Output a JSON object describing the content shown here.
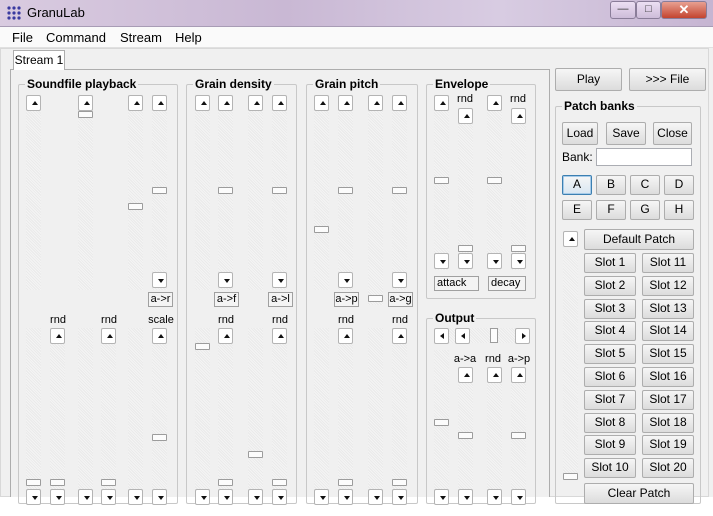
{
  "window": {
    "title": "GranuLab",
    "min": "—",
    "max": "□",
    "close": "✕"
  },
  "menu": [
    "File",
    "Command",
    "Stream",
    "Help"
  ],
  "tab": "Stream 1",
  "groups": {
    "soundfile": "Soundfile playback",
    "density": "Grain density",
    "pitch": "Grain pitch",
    "envelope": "Envelope",
    "output": "Output",
    "patchbanks": "Patch banks"
  },
  "labels": {
    "rnd": "rnd",
    "scale": "scale",
    "ar": "a->r",
    "af": "a->f",
    "al": "a->l",
    "ap": "a->p",
    "ag": "a->g",
    "aa": "a->a",
    "attack": "attack",
    "decay": "decay",
    "bank": "Bank:"
  },
  "buttons": {
    "play": "Play",
    "tofile": ">>> File",
    "load": "Load",
    "save": "Save",
    "close": "Close",
    "clear": "Clear Patch",
    "default_patch": "Default Patch"
  },
  "bank_input": "",
  "banks": [
    "A",
    "B",
    "C",
    "D",
    "E",
    "F",
    "G",
    "H"
  ],
  "selected_bank": "A",
  "slots": [
    "Slot 1",
    "Slot 2",
    "Slot 3",
    "Slot 4",
    "Slot 5",
    "Slot 6",
    "Slot 7",
    "Slot 8",
    "Slot 9",
    "Slot 10",
    "Slot 11",
    "Slot 12",
    "Slot 13",
    "Slot 14",
    "Slot 15",
    "Slot 16",
    "Slot 17",
    "Slot 18",
    "Slot 19",
    "Slot 20"
  ],
  "colors": {
    "accent": "#3c7fb1",
    "titlebar": "#d2c3dc"
  }
}
